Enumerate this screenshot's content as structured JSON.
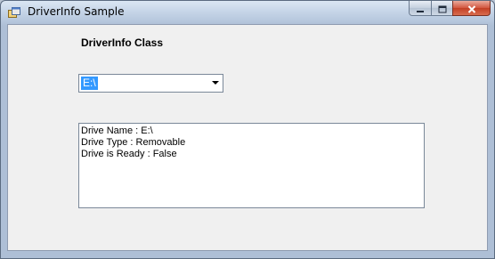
{
  "window": {
    "title": "DriverInfo Sample"
  },
  "main": {
    "heading": "DriverInfo Class",
    "drive_select": {
      "selected": "E:\\"
    },
    "info_lines": [
      "Drive Name : E:\\",
      "Drive Type : Removable",
      "Drive is Ready : False"
    ]
  },
  "icons": {
    "app": "app-window-icon",
    "minimize": "minimize-icon",
    "maximize": "maximize-icon",
    "close": "close-icon",
    "dropdown": "chevron-down-icon"
  },
  "colors": {
    "selection": "#3399ff",
    "close_button": "#c23f24",
    "client_background": "#f0f0f0"
  }
}
